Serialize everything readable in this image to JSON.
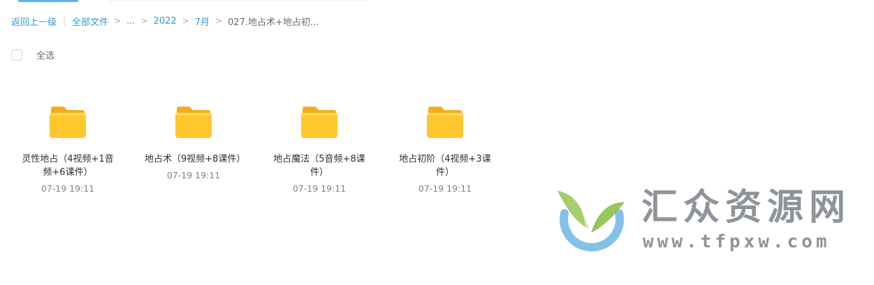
{
  "breadcrumb": {
    "back": "返回上一级",
    "separator_bar": "|",
    "root": "全部文件",
    "separator": ">",
    "ellipsis": "...",
    "year": "2022",
    "month": "7月",
    "current": "027.地占术+地占初..."
  },
  "toolbar": {
    "select_all_label": "全选"
  },
  "files": [
    {
      "name": "灵性地占（4视频+1音频+6课件）",
      "time": "07-19 19:11",
      "icon": "folder-icon"
    },
    {
      "name": "地占术（9视频+8课件）",
      "time": "07-19 19:11",
      "icon": "folder-icon"
    },
    {
      "name": "地占魔法（5音频+8课件）",
      "time": "07-19 19:11",
      "icon": "folder-icon"
    },
    {
      "name": "地占初阶（4视频+3课件）",
      "time": "07-19 19:11",
      "icon": "folder-icon"
    }
  ],
  "watermark": {
    "title": "汇众资源网",
    "url": "www.tfpxw.com"
  },
  "colors": {
    "link": "#2f9bd8",
    "folder": "#ffc62e",
    "folder_back": "#f5ac16",
    "watermark_text": "#8e9499",
    "logo_blue": "#6fb6e3",
    "logo_green": "#9cc95a"
  }
}
